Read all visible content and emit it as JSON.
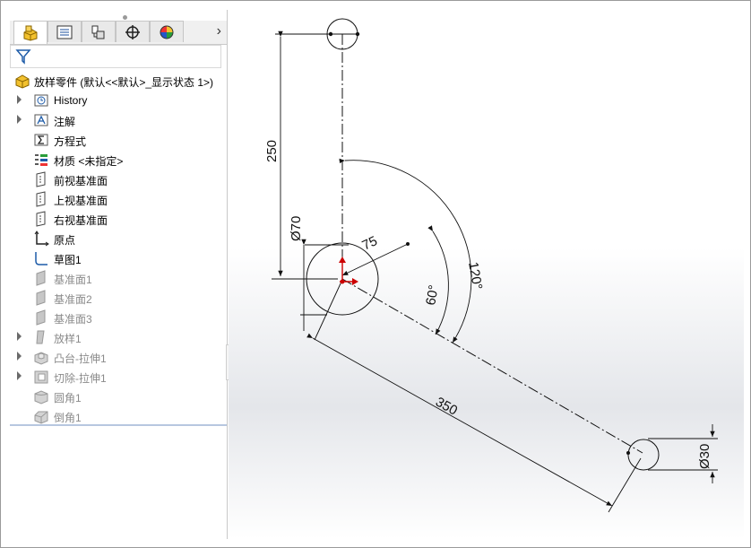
{
  "tabs": [
    {
      "name": "feature-manager-tab",
      "icon": "cube-feature-icon"
    },
    {
      "name": "property-manager-tab",
      "icon": "property-list-icon"
    },
    {
      "name": "configuration-manager-tab",
      "icon": "configuration-icon"
    },
    {
      "name": "dimxpert-tab",
      "icon": "crosshair-icon"
    },
    {
      "name": "display-manager-tab",
      "icon": "color-wheel-icon"
    }
  ],
  "tab_more": "›",
  "tree": {
    "root": "放样零件  (默认<<默认>_显示状态 1>)",
    "items": [
      {
        "label": "History",
        "expand": true,
        "dim": false,
        "icon": "history-folder-icon"
      },
      {
        "label": "注解",
        "expand": true,
        "dim": false,
        "icon": "annotations-icon"
      },
      {
        "label": "方程式",
        "expand": false,
        "dim": false,
        "icon": "equations-icon"
      },
      {
        "label": "材质 <未指定>",
        "expand": false,
        "dim": false,
        "icon": "material-icon"
      },
      {
        "label": "前视基准面",
        "expand": false,
        "dim": false,
        "icon": "plane-icon"
      },
      {
        "label": "上视基准面",
        "expand": false,
        "dim": false,
        "icon": "plane-icon"
      },
      {
        "label": "右视基准面",
        "expand": false,
        "dim": false,
        "icon": "plane-icon"
      },
      {
        "label": "原点",
        "expand": false,
        "dim": false,
        "icon": "origin-icon"
      },
      {
        "label": "草图1",
        "expand": false,
        "dim": false,
        "icon": "sketch-icon"
      },
      {
        "label": "基准面1",
        "expand": false,
        "dim": true,
        "icon": "ref-plane-icon"
      },
      {
        "label": "基准面2",
        "expand": false,
        "dim": true,
        "icon": "ref-plane-icon"
      },
      {
        "label": "基准面3",
        "expand": false,
        "dim": true,
        "icon": "ref-plane-icon"
      },
      {
        "label": "放样1",
        "expand": true,
        "dim": true,
        "icon": "loft-icon"
      },
      {
        "label": "凸台-拉伸1",
        "expand": true,
        "dim": true,
        "icon": "boss-extrude-icon"
      },
      {
        "label": "切除-拉伸1",
        "expand": true,
        "dim": true,
        "icon": "cut-extrude-icon"
      },
      {
        "label": "圆角1",
        "expand": false,
        "dim": true,
        "icon": "fillet-icon"
      },
      {
        "label": "倒角1",
        "expand": false,
        "dim": true,
        "icon": "chamfer-icon"
      }
    ]
  },
  "sketch": {
    "dim_250": "250",
    "dim_dia70": "Ø70",
    "dim_75": "75",
    "dim_60": "60°",
    "dim_120": "120°",
    "dim_350": "350",
    "dim_dia30": "Ø30"
  },
  "colors": {
    "accent": "#cc0000",
    "line": "#111111"
  }
}
